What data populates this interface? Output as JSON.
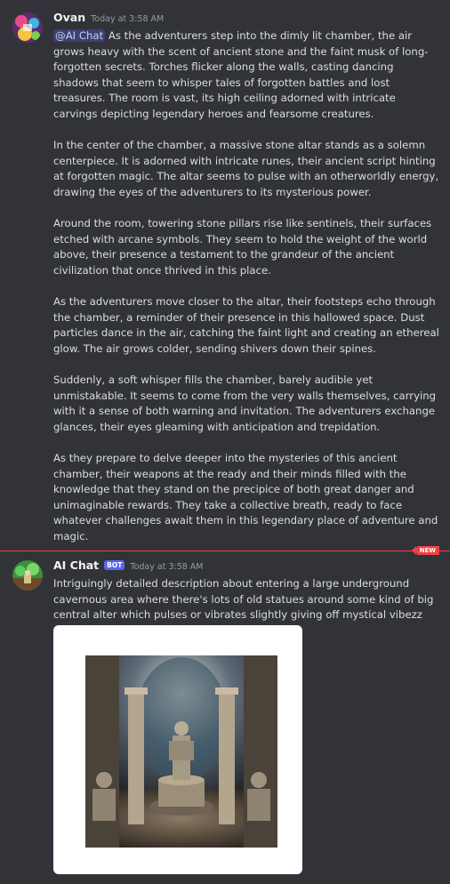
{
  "message1": {
    "username": "Ovan",
    "timestamp": "Today at 3:58 AM",
    "mention": "@AI Chat",
    "paragraphs": [
      " As the adventurers step into the dimly lit chamber, the air grows heavy with the scent of ancient stone and the faint musk of long-forgotten secrets. Torches flicker along the walls, casting dancing shadows that seem to whisper tales of forgotten battles and lost treasures. The room is vast, its high ceiling adorned with intricate carvings depicting legendary heroes and fearsome creatures.",
      "In the center of the chamber, a massive stone altar stands as a solemn centerpiece. It is adorned with intricate runes, their ancient script hinting at forgotten magic. The altar seems to pulse with an otherworldly energy, drawing the eyes of the adventurers to its mysterious power.",
      "Around the room, towering stone pillars rise like sentinels, their surfaces etched with arcane symbols. They seem to hold the weight of the world above, their presence a testament to the grandeur of the ancient civilization that once thrived in this place.",
      "As the adventurers move closer to the altar, their footsteps echo through the chamber, a reminder of their presence in this hallowed space. Dust particles dance in the air, catching the faint light and creating an ethereal glow. The air grows colder, sending shivers down their spines.",
      "Suddenly, a soft whisper fills the chamber, barely audible yet unmistakable. It seems to come from the very walls themselves, carrying with it a sense of both warning and invitation. The adventurers exchange glances, their eyes gleaming with anticipation and trepidation.",
      "As they prepare to delve deeper into the mysteries of this ancient chamber, their weapons at the ready and their minds filled with the knowledge that they stand on the precipice of both great danger and unimaginable rewards. They take a collective breath, ready to face whatever challenges await them in this legendary place of adventure and magic."
    ]
  },
  "divider": {
    "label": "NEW",
    "color": "#f23f43"
  },
  "message2": {
    "username": "AI Chat",
    "bot_badge": "BOT",
    "timestamp": "Today at 3:58 AM",
    "text": "Intriguingly detailed description about entering a large underground cavernous area where there's lots of old statues around some kind of big central alter which pulses or vibrates slightly giving off mystical vibezz"
  },
  "colors": {
    "background": "#313338",
    "mention_bg": "#3c4270",
    "bot_badge": "#5865f2"
  }
}
